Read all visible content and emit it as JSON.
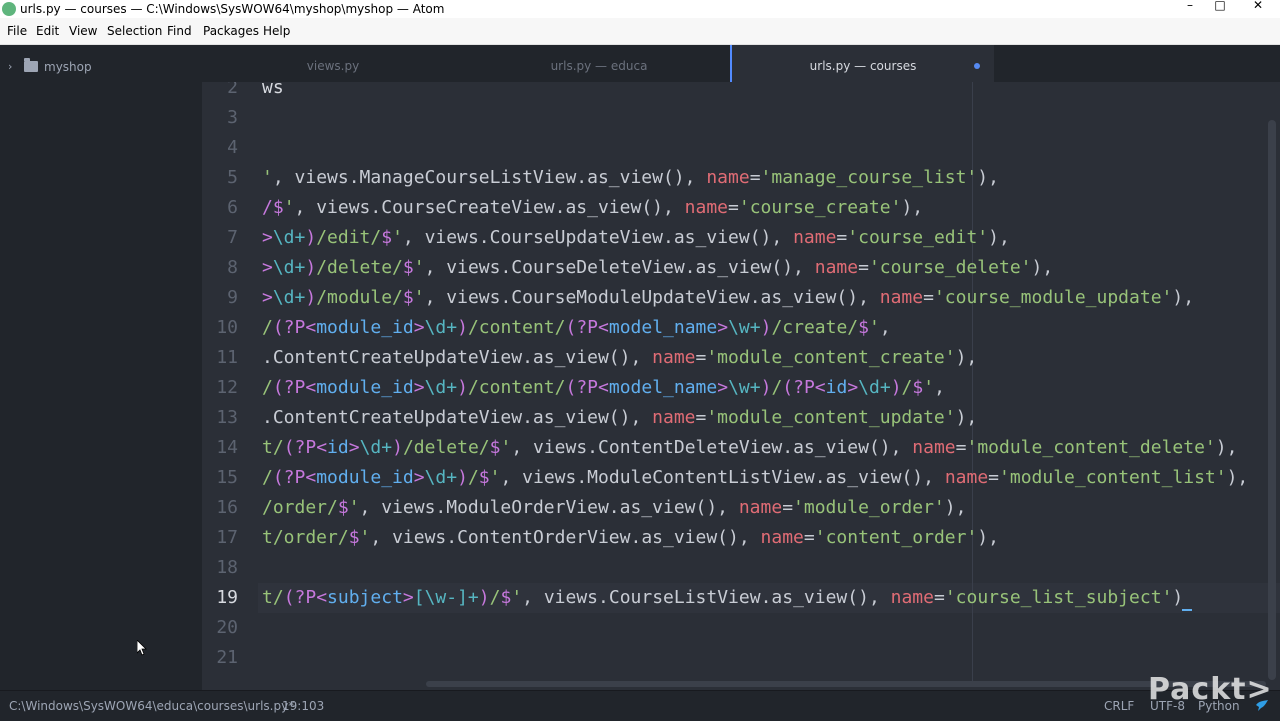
{
  "window": {
    "title": "urls.py — courses — C:\\Windows\\SysWOW64\\myshop\\myshop — Atom",
    "controls": {
      "minimize": "–",
      "maximize": "□",
      "close": "✕"
    }
  },
  "menubar": {
    "items": [
      "File",
      "Edit",
      "View",
      "Selection",
      "Find",
      "Packages",
      "Help"
    ]
  },
  "tree": {
    "root_label": "myshop",
    "chevron": "›"
  },
  "tabs": [
    {
      "label": "views.py",
      "active": false
    },
    {
      "label": "urls.py — educa",
      "active": false
    },
    {
      "label": "urls.py — courses",
      "active": true,
      "modified": true
    }
  ],
  "editor": {
    "current_line": 19,
    "lines": [
      {
        "no": "2",
        "tokens": [
          {
            "c": "t-text",
            "t": "ws"
          }
        ]
      },
      {
        "no": "3",
        "tokens": []
      },
      {
        "no": "4",
        "tokens": []
      },
      {
        "no": "5",
        "tokens": [
          {
            "c": "t-str",
            "t": "'"
          },
          {
            "c": "t-plain",
            "t": ", views.ManageCourseListView.as_view(), "
          },
          {
            "c": "t-kw",
            "t": "name"
          },
          {
            "c": "t-plain",
            "t": "="
          },
          {
            "c": "t-str",
            "t": "'manage_course_list'"
          },
          {
            "c": "t-plain",
            "t": "),"
          }
        ]
      },
      {
        "no": "6",
        "tokens": [
          {
            "c": "t-punc",
            "t": "/$"
          },
          {
            "c": "t-str",
            "t": "'"
          },
          {
            "c": "t-plain",
            "t": ", views.CourseCreateView.as_view(), "
          },
          {
            "c": "t-kw",
            "t": "name"
          },
          {
            "c": "t-plain",
            "t": "="
          },
          {
            "c": "t-str",
            "t": "'course_create'"
          },
          {
            "c": "t-plain",
            "t": "),"
          }
        ]
      },
      {
        "no": "7",
        "tokens": [
          {
            "c": "t-punc",
            "t": ">"
          },
          {
            "c": "t-esc",
            "t": "\\d+"
          },
          {
            "c": "t-punc",
            "t": ")"
          },
          {
            "c": "t-str",
            "t": "/edit/"
          },
          {
            "c": "t-punc",
            "t": "$"
          },
          {
            "c": "t-str",
            "t": "'"
          },
          {
            "c": "t-plain",
            "t": ", views.CourseUpdateView.as_view(), "
          },
          {
            "c": "t-kw",
            "t": "name"
          },
          {
            "c": "t-plain",
            "t": "="
          },
          {
            "c": "t-str",
            "t": "'course_edit'"
          },
          {
            "c": "t-plain",
            "t": "),"
          }
        ]
      },
      {
        "no": "8",
        "tokens": [
          {
            "c": "t-punc",
            "t": ">"
          },
          {
            "c": "t-esc",
            "t": "\\d+"
          },
          {
            "c": "t-punc",
            "t": ")"
          },
          {
            "c": "t-str",
            "t": "/delete/"
          },
          {
            "c": "t-punc",
            "t": "$"
          },
          {
            "c": "t-str",
            "t": "'"
          },
          {
            "c": "t-plain",
            "t": ", views.CourseDeleteView.as_view(), "
          },
          {
            "c": "t-kw",
            "t": "name"
          },
          {
            "c": "t-plain",
            "t": "="
          },
          {
            "c": "t-str",
            "t": "'course_delete'"
          },
          {
            "c": "t-plain",
            "t": "),"
          }
        ]
      },
      {
        "no": "9",
        "tokens": [
          {
            "c": "t-punc",
            "t": ">"
          },
          {
            "c": "t-esc",
            "t": "\\d+"
          },
          {
            "c": "t-punc",
            "t": ")"
          },
          {
            "c": "t-str",
            "t": "/module/"
          },
          {
            "c": "t-punc",
            "t": "$"
          },
          {
            "c": "t-str",
            "t": "'"
          },
          {
            "c": "t-plain",
            "t": ", views.CourseModuleUpdateView.as_view(), "
          },
          {
            "c": "t-kw",
            "t": "name"
          },
          {
            "c": "t-plain",
            "t": "="
          },
          {
            "c": "t-str",
            "t": "'course_module_update'"
          },
          {
            "c": "t-plain",
            "t": "),"
          }
        ]
      },
      {
        "no": "10",
        "tokens": [
          {
            "c": "t-str",
            "t": "/"
          },
          {
            "c": "t-punc",
            "t": "(?P<"
          },
          {
            "c": "t-group",
            "t": "module_id"
          },
          {
            "c": "t-punc",
            "t": ">"
          },
          {
            "c": "t-esc",
            "t": "\\d+"
          },
          {
            "c": "t-punc",
            "t": ")"
          },
          {
            "c": "t-str",
            "t": "/content/"
          },
          {
            "c": "t-punc",
            "t": "(?P<"
          },
          {
            "c": "t-group",
            "t": "model_name"
          },
          {
            "c": "t-punc",
            "t": ">"
          },
          {
            "c": "t-esc",
            "t": "\\w+"
          },
          {
            "c": "t-punc",
            "t": ")"
          },
          {
            "c": "t-str",
            "t": "/create/"
          },
          {
            "c": "t-punc",
            "t": "$"
          },
          {
            "c": "t-str",
            "t": "'"
          },
          {
            "c": "t-plain",
            "t": ","
          }
        ]
      },
      {
        "no": "11",
        "tokens": [
          {
            "c": "t-plain",
            "t": ".ContentCreateUpdateView.as_view(), "
          },
          {
            "c": "t-kw",
            "t": "name"
          },
          {
            "c": "t-plain",
            "t": "="
          },
          {
            "c": "t-str",
            "t": "'module_content_create'"
          },
          {
            "c": "t-plain",
            "t": "),"
          }
        ]
      },
      {
        "no": "12",
        "tokens": [
          {
            "c": "t-str",
            "t": "/"
          },
          {
            "c": "t-punc",
            "t": "(?P<"
          },
          {
            "c": "t-group",
            "t": "module_id"
          },
          {
            "c": "t-punc",
            "t": ">"
          },
          {
            "c": "t-esc",
            "t": "\\d+"
          },
          {
            "c": "t-punc",
            "t": ")"
          },
          {
            "c": "t-str",
            "t": "/content/"
          },
          {
            "c": "t-punc",
            "t": "(?P<"
          },
          {
            "c": "t-group",
            "t": "model_name"
          },
          {
            "c": "t-punc",
            "t": ">"
          },
          {
            "c": "t-esc",
            "t": "\\w+"
          },
          {
            "c": "t-punc",
            "t": ")"
          },
          {
            "c": "t-str",
            "t": "/"
          },
          {
            "c": "t-punc",
            "t": "(?P<"
          },
          {
            "c": "t-group",
            "t": "id"
          },
          {
            "c": "t-punc",
            "t": ">"
          },
          {
            "c": "t-esc",
            "t": "\\d+"
          },
          {
            "c": "t-punc",
            "t": ")"
          },
          {
            "c": "t-str",
            "t": "/"
          },
          {
            "c": "t-punc",
            "t": "$"
          },
          {
            "c": "t-str",
            "t": "'"
          },
          {
            "c": "t-plain",
            "t": ","
          }
        ]
      },
      {
        "no": "13",
        "tokens": [
          {
            "c": "t-plain",
            "t": ".ContentCreateUpdateView.as_view(), "
          },
          {
            "c": "t-kw",
            "t": "name"
          },
          {
            "c": "t-plain",
            "t": "="
          },
          {
            "c": "t-str",
            "t": "'module_content_update'"
          },
          {
            "c": "t-plain",
            "t": "),"
          }
        ]
      },
      {
        "no": "14",
        "tokens": [
          {
            "c": "t-str",
            "t": "t/"
          },
          {
            "c": "t-punc",
            "t": "(?P<"
          },
          {
            "c": "t-group",
            "t": "id"
          },
          {
            "c": "t-punc",
            "t": ">"
          },
          {
            "c": "t-esc",
            "t": "\\d+"
          },
          {
            "c": "t-punc",
            "t": ")"
          },
          {
            "c": "t-str",
            "t": "/delete/"
          },
          {
            "c": "t-punc",
            "t": "$"
          },
          {
            "c": "t-str",
            "t": "'"
          },
          {
            "c": "t-plain",
            "t": ", views.ContentDeleteView.as_view(), "
          },
          {
            "c": "t-kw",
            "t": "name"
          },
          {
            "c": "t-plain",
            "t": "="
          },
          {
            "c": "t-str",
            "t": "'module_content_delete'"
          },
          {
            "c": "t-plain",
            "t": "),"
          }
        ]
      },
      {
        "no": "15",
        "tokens": [
          {
            "c": "t-str",
            "t": "/"
          },
          {
            "c": "t-punc",
            "t": "(?P<"
          },
          {
            "c": "t-group",
            "t": "module_id"
          },
          {
            "c": "t-punc",
            "t": ">"
          },
          {
            "c": "t-esc",
            "t": "\\d+"
          },
          {
            "c": "t-punc",
            "t": ")"
          },
          {
            "c": "t-str",
            "t": "/"
          },
          {
            "c": "t-punc",
            "t": "$"
          },
          {
            "c": "t-str",
            "t": "'"
          },
          {
            "c": "t-plain",
            "t": ", views.ModuleContentListView.as_view(), "
          },
          {
            "c": "t-kw",
            "t": "name"
          },
          {
            "c": "t-plain",
            "t": "="
          },
          {
            "c": "t-str",
            "t": "'module_content_list'"
          },
          {
            "c": "t-plain",
            "t": "),"
          }
        ]
      },
      {
        "no": "16",
        "tokens": [
          {
            "c": "t-str",
            "t": "/order/"
          },
          {
            "c": "t-punc",
            "t": "$"
          },
          {
            "c": "t-str",
            "t": "'"
          },
          {
            "c": "t-plain",
            "t": ", views.ModuleOrderView.as_view(), "
          },
          {
            "c": "t-kw",
            "t": "name"
          },
          {
            "c": "t-plain",
            "t": "="
          },
          {
            "c": "t-str",
            "t": "'module_order'"
          },
          {
            "c": "t-plain",
            "t": "),"
          }
        ]
      },
      {
        "no": "17",
        "tokens": [
          {
            "c": "t-str",
            "t": "t/order/"
          },
          {
            "c": "t-punc",
            "t": "$"
          },
          {
            "c": "t-str",
            "t": "'"
          },
          {
            "c": "t-plain",
            "t": ", views.ContentOrderView.as_view(), "
          },
          {
            "c": "t-kw",
            "t": "name"
          },
          {
            "c": "t-plain",
            "t": "="
          },
          {
            "c": "t-str",
            "t": "'content_order'"
          },
          {
            "c": "t-plain",
            "t": "),"
          }
        ]
      },
      {
        "no": "18",
        "tokens": []
      },
      {
        "no": "19",
        "tokens": [
          {
            "c": "t-str",
            "t": "t/"
          },
          {
            "c": "t-punc",
            "t": "(?P<"
          },
          {
            "c": "t-group",
            "t": "subject"
          },
          {
            "c": "t-punc",
            "t": ">"
          },
          {
            "c": "t-esc",
            "t": "[\\w-]+"
          },
          {
            "c": "t-punc",
            "t": ")"
          },
          {
            "c": "t-str",
            "t": "/"
          },
          {
            "c": "t-punc",
            "t": "$"
          },
          {
            "c": "t-str",
            "t": "'"
          },
          {
            "c": "t-plain",
            "t": ", views.CourseListView.as_view(), "
          },
          {
            "c": "t-kw",
            "t": "name"
          },
          {
            "c": "t-plain",
            "t": "="
          },
          {
            "c": "t-str",
            "t": "'course_list_subject'"
          },
          {
            "c": "t-plain",
            "t": ")"
          }
        ]
      },
      {
        "no": "20",
        "tokens": []
      },
      {
        "no": "21",
        "tokens": []
      }
    ]
  },
  "statusbar": {
    "path": "C:\\Windows\\SysWOW64\\educa\\courses\\urls.py*",
    "cursor_position": "19:103",
    "line_ending": "CRLF",
    "encoding": "UTF-8",
    "grammar": "Python",
    "bird_icon": "bird-icon"
  },
  "watermark": {
    "text": "Packt>"
  },
  "colors": {
    "string": "#98c379",
    "escape": "#56b6c2",
    "punctuation": "#c678dd",
    "keyword_arg": "#e06c75",
    "group_name": "#61afef",
    "editor_bg": "#2b2f37",
    "accent": "#528bff"
  }
}
